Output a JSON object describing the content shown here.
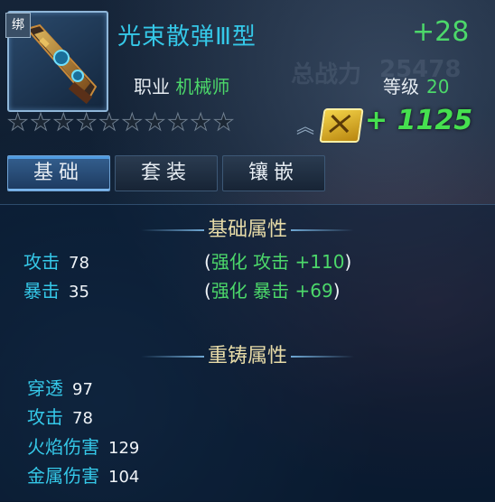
{
  "item": {
    "bind_badge": "绑",
    "name": "光束散弹Ⅲ型",
    "enhance": "+28",
    "job_label": "职业",
    "job_value": "机械师",
    "level_label": "等级",
    "level_value": "20",
    "star_count": 10,
    "power_value": "+ 1125"
  },
  "tabs": [
    {
      "label": "基础",
      "active": true
    },
    {
      "label": "套装",
      "active": false
    },
    {
      "label": "镶嵌",
      "active": false
    }
  ],
  "base_section": {
    "title": "基础属性",
    "stats": [
      {
        "label": "攻击",
        "value": "78",
        "bonus_open": "(",
        "bonus_label": "强化 攻击",
        "bonus_value": "+110",
        "bonus_close": ")"
      },
      {
        "label": "暴击",
        "value": "35",
        "bonus_open": "(",
        "bonus_label": "强化 暴击",
        "bonus_value": "+69",
        "bonus_close": ")"
      }
    ]
  },
  "recast_section": {
    "title": "重铸属性",
    "stats": [
      {
        "label": "穿透",
        "value": "97"
      },
      {
        "label": "攻击",
        "value": "78"
      },
      {
        "label": "火焰伤害",
        "value": "129"
      },
      {
        "label": "金属伤害",
        "value": "104"
      }
    ]
  },
  "background_text": {
    "total_power": "总战力",
    "total_power_value": "25478"
  }
}
